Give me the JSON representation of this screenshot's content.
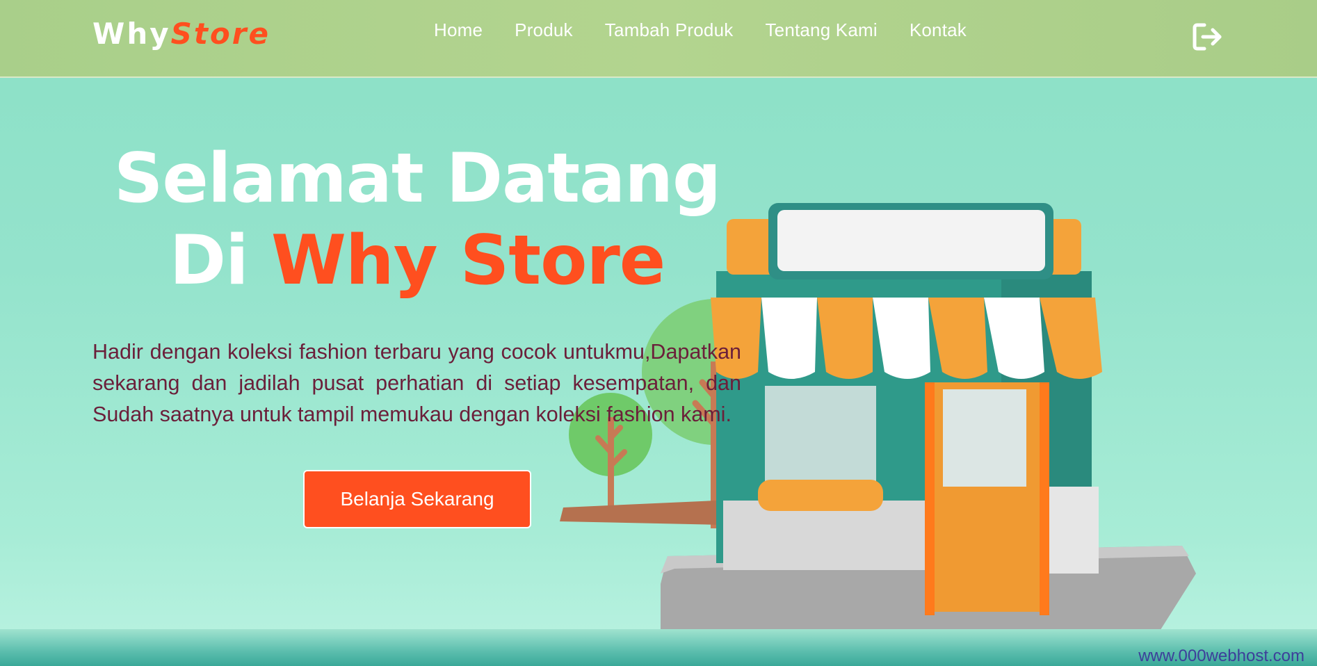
{
  "brand": {
    "name_part1": "Why",
    "name_part2": "Store"
  },
  "nav": {
    "items": [
      {
        "label": "Home"
      },
      {
        "label": "Produk"
      },
      {
        "label": "Tambah Produk"
      },
      {
        "label": "Tentang Kami"
      },
      {
        "label": "Kontak"
      }
    ],
    "logout_icon": "logout-icon"
  },
  "hero": {
    "title_line1": "Selamat Datang",
    "title_line2_prefix": "Di",
    "title_line2_accent": "Why Store",
    "description": "Hadir dengan koleksi fashion terbaru yang cocok untukmu,Dapatkan sekarang dan jadilah pusat perhatian di setiap kesempatan, dan Sudah saatnya untuk tampil memukau dengan koleksi fashion kami.",
    "cta_label": "Belanja Sekarang"
  },
  "footer": {
    "watermark": "www.000webhost.com"
  },
  "colors": {
    "accent": "#ff4f1f",
    "navbar": "#afd18c",
    "background": "#8be0c6",
    "description_text": "#6b1f3a"
  }
}
